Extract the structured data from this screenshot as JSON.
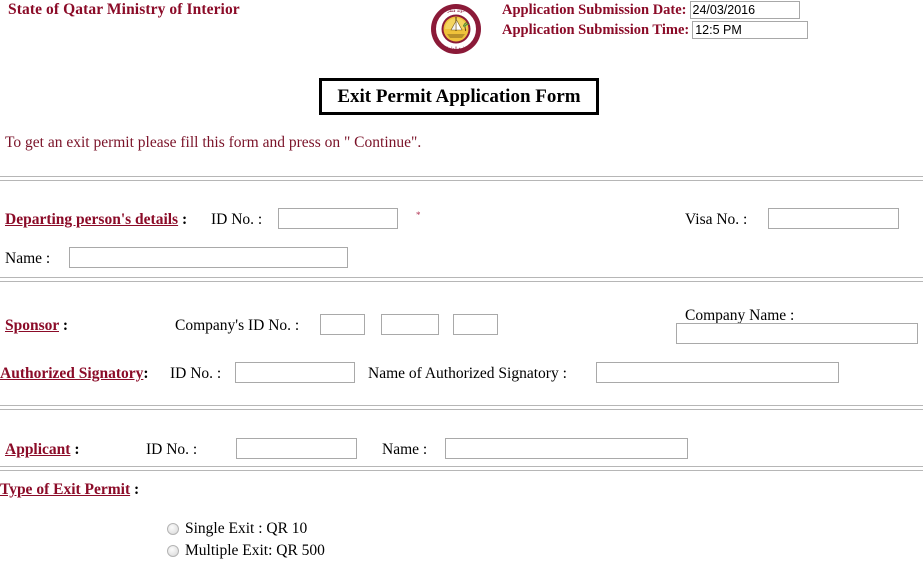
{
  "header": {
    "org_title": "State of Qatar Ministry of Interior",
    "logo_name": "qatar-moi-emblem",
    "submission_date_label": "Application Submission Date:",
    "submission_date_value": "24/03/2016",
    "submission_time_label": "Application Submission Time:",
    "submission_time_value": "12:5 PM"
  },
  "form": {
    "title": "Exit Permit Application Form",
    "instruction": "To get an exit permit please fill this form and press on \" Continue\"."
  },
  "departing": {
    "section_label": "Departing person's details",
    "section_colon": " :",
    "id_label": "ID No. :",
    "id_value": "",
    "required_mark": "*",
    "visa_label": "Visa No. :",
    "visa_value": "",
    "name_label": "Name :",
    "name_value": ""
  },
  "sponsor": {
    "section_label": "Sponsor",
    "section_colon": " :",
    "company_id_label": "Company's ID No. :",
    "company_id_part1": "",
    "company_id_part2": "",
    "company_id_part3": "",
    "company_name_label": "Company Name :",
    "company_name_value": ""
  },
  "signatory": {
    "section_label": "Authorized Signatory",
    "section_colon": ":",
    "id_label": "ID No. :",
    "id_value": "",
    "name_label": "Name of Authorized Signatory :",
    "name_value": ""
  },
  "applicant": {
    "section_label": "Applicant",
    "section_colon": " :",
    "id_label": "ID No. :",
    "id_value": "",
    "name_label": "Name :",
    "name_value": ""
  },
  "permit_type": {
    "section_label": "Type of Exit Permit",
    "section_colon": " :",
    "options": [
      {
        "label": "Single Exit : QR 10",
        "selected": false
      },
      {
        "label": "Multiple Exit: QR 500",
        "selected": false
      }
    ]
  },
  "colors": {
    "maroon": "#8b0b28",
    "instruction_maroon": "#7a1228",
    "field_border": "#a9a9a9",
    "separator": "#b6b6b6"
  }
}
